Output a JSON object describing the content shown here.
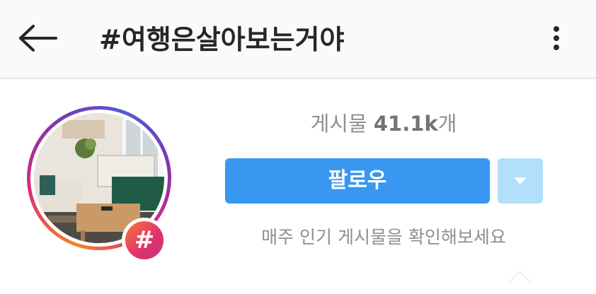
{
  "header": {
    "title": "#여행은살아보는거야",
    "back_icon": "arrow-left-icon",
    "menu_icon": "more-vertical-icon"
  },
  "profile": {
    "badge_symbol": "#",
    "posts_prefix": "게시물 ",
    "posts_count": "41.1k",
    "posts_suffix": "개"
  },
  "actions": {
    "follow_label": "팔로우",
    "dropdown_icon": "caret-down-icon",
    "subtext": "매주 인기 게시물을 확인해보세요"
  },
  "colors": {
    "primary_button": "#3897f0",
    "secondary_button": "#b2dffc",
    "muted_text": "#8e8e8e"
  }
}
